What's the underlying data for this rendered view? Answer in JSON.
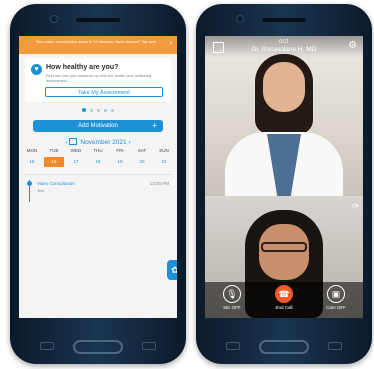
{
  "left_phone": {
    "banner_text": "Your video consultation starts in 10 minutes. Need Ireland? Tap now",
    "banner_chevron": "›",
    "health_card": {
      "icon": "heart-icon",
      "title": "How healthy are you?",
      "description": "Find out how you measure up with the health and wellbeing assessment",
      "button_label": "Take My Assessment"
    },
    "add_motivation_label": "Add Motivation",
    "add_icon": "+",
    "calendar": {
      "prev": "‹",
      "month": "November 2021",
      "next": "›",
      "weekdays": [
        "MON",
        "TUE",
        "WED",
        "THU",
        "FRI",
        "SAT",
        "SUN"
      ],
      "days": [
        "15",
        "16",
        "17",
        "18",
        "19",
        "20",
        "21"
      ],
      "selected_day": "16"
    },
    "event": {
      "title": "Video Consultation",
      "time": "12:00 PM",
      "subtitle": "Test"
    },
    "accent_color": "#1e90d6",
    "banner_color": "#f39a3c"
  },
  "right_phone": {
    "call_time": "0:01",
    "doctor_name": "Dr. Rocasolano H. MD",
    "settings_icon": "gear-icon",
    "controls": {
      "mic": "Mic OFF",
      "end": "End Call",
      "cam": "Cam OFF"
    },
    "end_call_color": "#f05a28"
  }
}
